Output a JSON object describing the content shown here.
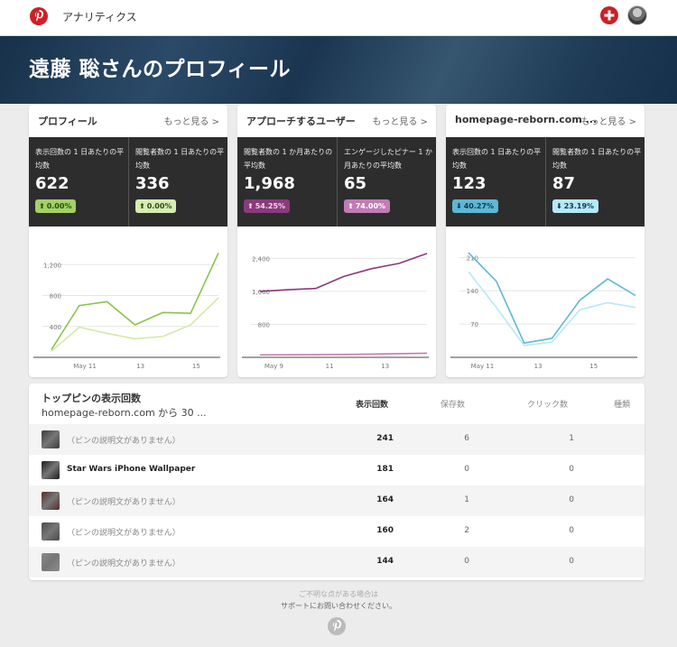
{
  "header": {
    "app_title": "アナリティクス"
  },
  "banner": {
    "title": "遠藤 聡さんのプロフィール"
  },
  "cards": [
    {
      "title": "プロフィール",
      "more": "もっと見る >",
      "stats": [
        {
          "label": "表示回数の 1 日あたりの平均数",
          "value": "622",
          "change": "0.00%",
          "direction": "up",
          "badge_bg": "#a4d166",
          "badge_fg": "#2f4a12"
        },
        {
          "label": "閲覧者数の 1 日あたりの平均数",
          "value": "336",
          "change": "0.00%",
          "direction": "up",
          "badge_bg": "#d6ecb2",
          "badge_fg": "#2f4a12"
        }
      ]
    },
    {
      "title": "アプローチするユーザー",
      "more": "もっと見る >",
      "stats": [
        {
          "label": "閲覧者数の 1 か月あたりの平均数",
          "value": "1,968",
          "change": "54.25%",
          "direction": "up",
          "badge_bg": "#8a3a7c",
          "badge_fg": "#f2d6ec"
        },
        {
          "label": "エンゲージしたピナー 1 か月あたりの平均数",
          "value": "65",
          "change": "74.00%",
          "direction": "up",
          "badge_bg": "#c27bb5",
          "badge_fg": "#ffffff"
        }
      ]
    },
    {
      "title": "homepage-reborn.com ...",
      "more": "もっと見る >",
      "stats": [
        {
          "label": "表示回数の 1 日あたりの平均数",
          "value": "123",
          "change": "40.27%",
          "direction": "down",
          "badge_bg": "#5db8d4",
          "badge_fg": "#0f3a4a"
        },
        {
          "label": "閲覧者数の 1 日あたりの平均数",
          "value": "87",
          "change": "23.19%",
          "direction": "down",
          "badge_bg": "#b6e8f7",
          "badge_fg": "#0f3a4a"
        }
      ]
    }
  ],
  "chart_data": [
    {
      "type": "line",
      "ylim": [
        0,
        1600
      ],
      "yticks": [
        400,
        800,
        1200
      ],
      "ytick_labels": [
        "400",
        "800",
        "1,200"
      ],
      "x": [
        1,
        2,
        3,
        4,
        5,
        6,
        7
      ],
      "xtick_labels": [
        {
          "x": 2.2,
          "label": "May 11"
        },
        {
          "x": 4.2,
          "label": "13"
        },
        {
          "x": 6.2,
          "label": "15"
        }
      ],
      "series": [
        {
          "color": "#8bc34a",
          "values": [
            100,
            670,
            720,
            420,
            580,
            570,
            1350
          ]
        },
        {
          "color": "#d4e9a8",
          "values": [
            80,
            390,
            310,
            240,
            270,
            420,
            770
          ]
        }
      ]
    },
    {
      "type": "line",
      "ylim": [
        0,
        3000
      ],
      "yticks": [
        800,
        1600,
        2400
      ],
      "ytick_labels": [
        "800",
        "1,600",
        "2,400"
      ],
      "x": [
        1,
        2,
        3,
        4,
        5,
        6,
        7
      ],
      "xtick_labels": [
        {
          "x": 1.5,
          "label": "May 9"
        },
        {
          "x": 3.5,
          "label": "11"
        },
        {
          "x": 5.5,
          "label": "13"
        }
      ],
      "series": [
        {
          "color": "#8a3a7c",
          "values": [
            1600,
            1640,
            1670,
            1960,
            2150,
            2280,
            2520
          ]
        },
        {
          "color": "#c27bb5",
          "values": [
            60,
            62,
            65,
            70,
            78,
            88,
            100
          ]
        }
      ]
    },
    {
      "type": "line",
      "ylim": [
        0,
        260
      ],
      "yticks": [
        70,
        140,
        210
      ],
      "ytick_labels": [
        "70",
        "140",
        "210"
      ],
      "x": [
        1,
        2,
        3,
        4,
        5,
        6,
        7
      ],
      "xtick_labels": [
        {
          "x": 1.5,
          "label": "May 11"
        },
        {
          "x": 3.5,
          "label": "13"
        },
        {
          "x": 5.5,
          "label": "15"
        }
      ],
      "series": [
        {
          "color": "#5db8d4",
          "values": [
            220,
            160,
            30,
            40,
            120,
            165,
            130
          ]
        },
        {
          "color": "#b6e8f7",
          "values": [
            180,
            105,
            25,
            32,
            100,
            115,
            105
          ]
        }
      ]
    }
  ],
  "top_pins": {
    "title": "トップピンの表示回数",
    "subtitle": "homepage-reborn.com から 30 ...",
    "columns": [
      "表示回数",
      "保存数",
      "クリック数",
      "種類"
    ],
    "rows": [
      {
        "desc": "（ピンの説明文がありません）",
        "named": false,
        "impressions": "241",
        "saves": "6",
        "clicks": "1",
        "thumb": "#3c3c3c"
      },
      {
        "desc": "Star Wars iPhone Wallpaper",
        "named": true,
        "impressions": "181",
        "saves": "0",
        "clicks": "0",
        "thumb": "#1c1c1c"
      },
      {
        "desc": "（ピンの説明文がありません）",
        "named": false,
        "impressions": "164",
        "saves": "1",
        "clicks": "0",
        "thumb": "#5a2a2a"
      },
      {
        "desc": "（ピンの説明文がありません）",
        "named": false,
        "impressions": "160",
        "saves": "2",
        "clicks": "0",
        "thumb": "#4a4a4a"
      },
      {
        "desc": "（ピンの説明文がありません）",
        "named": false,
        "impressions": "144",
        "saves": "0",
        "clicks": "0",
        "thumb": "#8a8a8a"
      }
    ]
  },
  "footer": {
    "line1": "ご不明な点がある場合は",
    "line2": "サポートにお問い合わせください。"
  }
}
